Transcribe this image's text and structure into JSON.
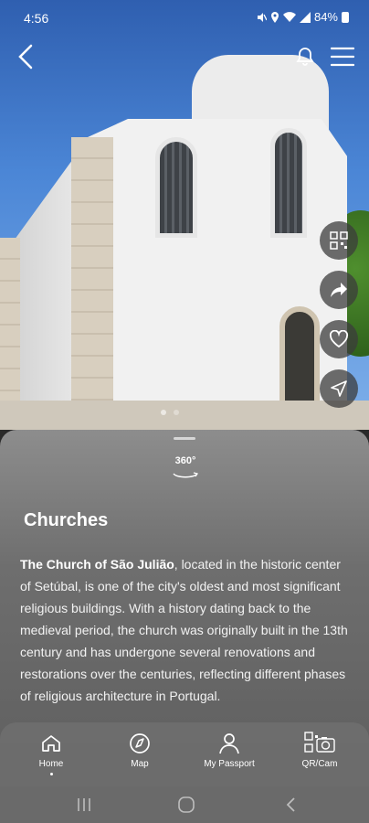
{
  "status_bar": {
    "time": "4:56",
    "battery": "84%",
    "icons": [
      "mute-icon",
      "location-icon",
      "wifi-icon",
      "signal-icon",
      "battery-icon"
    ]
  },
  "top_bar": {
    "back_icon": "chevron-left-icon",
    "notifications_icon": "bell-icon",
    "menu_icon": "hamburger-menu-icon"
  },
  "actions": [
    {
      "name": "qr-code",
      "icon": "qr-code-icon"
    },
    {
      "name": "share",
      "icon": "share-icon"
    },
    {
      "name": "favorite",
      "icon": "heart-icon"
    },
    {
      "name": "navigate",
      "icon": "navigation-arrow-icon"
    }
  ],
  "sheet": {
    "badge_360": "360°",
    "heading": "Churches",
    "description_bold": "The Church of São Julião",
    "description_rest": ", located in the historic center of Setúbal, is one of the city's oldest and most significant religious buildings. With a history dating back to the medieval period, the church was originally built in the 13th century and has undergone several renovations and restorations over the centuries, reflecting different phases of religious architecture in Portugal."
  },
  "bottom_nav": {
    "items": [
      {
        "label": "Home",
        "icon": "home-icon",
        "active": true
      },
      {
        "label": "Map",
        "icon": "compass-icon",
        "active": false
      },
      {
        "label": "My Passport",
        "icon": "user-icon",
        "active": false
      },
      {
        "label": "QR/Cam",
        "icon": "qr-camera-icon",
        "active": false
      }
    ]
  },
  "system_nav": [
    "recent-apps-icon",
    "home-circle-icon",
    "back-icon"
  ]
}
